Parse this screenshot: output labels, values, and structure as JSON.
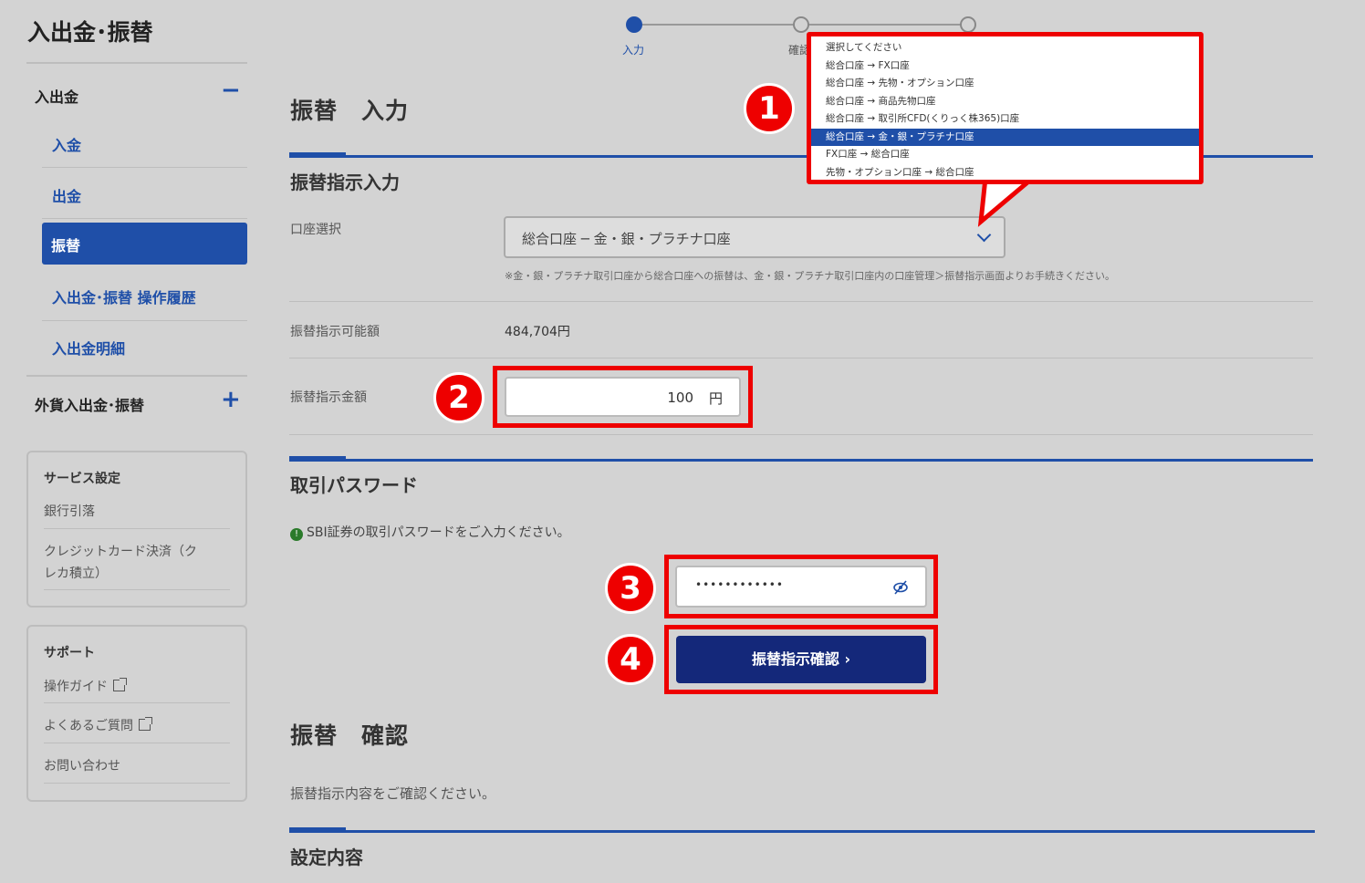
{
  "sidebar": {
    "title": "入出金･振替",
    "section1": {
      "label": "入出金",
      "toggle": "−"
    },
    "items": [
      "入金",
      "出金",
      "振替",
      "入出金･振替 操作履歴",
      "入出金明細"
    ],
    "section2": {
      "label": "外貨入出金･振替",
      "toggle": "+"
    },
    "service": {
      "title": "サービス設定",
      "links": [
        "銀行引落",
        "クレジットカード決済（ク",
        "レカ積立）"
      ]
    },
    "support": {
      "title": "サポート",
      "links": [
        "操作ガイド",
        "よくあるご質問",
        "お問い合わせ"
      ]
    }
  },
  "stepper": {
    "steps": [
      "入力",
      "確認",
      ""
    ]
  },
  "main": {
    "title": "振替　入力",
    "section_instruction": "振替指示入力",
    "account_label": "口座選択",
    "account_value": "総合口座 ─ 金・銀・プラチナ口座",
    "account_note": "※金・銀・プラチナ取引口座から総合口座への振替は、金・銀・プラチナ取引口座内の口座管理＞振替指示画面よりお手続きください。",
    "available_label": "振替指示可能額",
    "available_value": "484,704円",
    "amount_label": "振替指示金額",
    "amount_value": "100",
    "amount_unit": "円",
    "password_section": "取引パスワード",
    "password_hint": "SBI証券の取引パスワードをご入力ください。",
    "password_mask": "••••••••••••",
    "confirm_button": "振替指示確認 ›",
    "confirm_title": "振替　確認",
    "confirm_text": "振替指示内容をご確認ください。",
    "settings_section": "設定内容"
  },
  "dropdown": {
    "options": [
      "選択してください",
      "総合口座 → FX口座",
      "総合口座 → 先物・オプション口座",
      "総合口座 → 商品先物口座",
      "総合口座 → 取引所CFD(くりっく株365)口座",
      "総合口座 → 金・銀・プラチナ口座",
      "FX口座 → 総合口座",
      "先物・オプション口座 → 総合口座"
    ],
    "selected_index": 5
  },
  "badges": [
    "1",
    "2",
    "3",
    "4"
  ],
  "colors": {
    "accent": "#1f4fa8",
    "highlight": "#e00000",
    "button": "#14287a"
  }
}
